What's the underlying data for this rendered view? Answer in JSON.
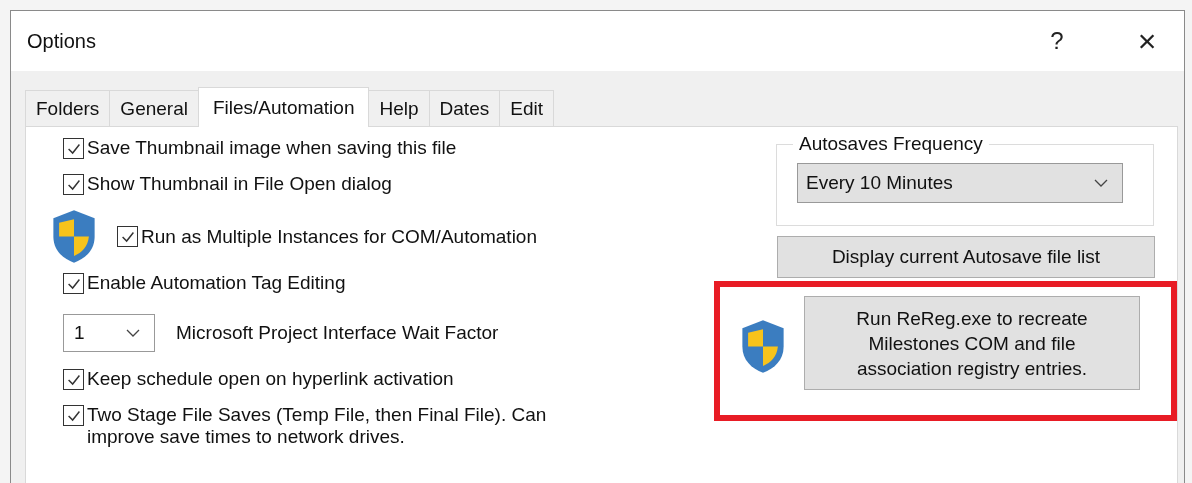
{
  "window": {
    "title": "Options",
    "help_button": "?",
    "close_button": "×"
  },
  "tabs": [
    {
      "label": "Folders",
      "selected": false
    },
    {
      "label": "General",
      "selected": false
    },
    {
      "label": "Files/Automation",
      "selected": true
    },
    {
      "label": "Help",
      "selected": false
    },
    {
      "label": "Dates",
      "selected": false
    },
    {
      "label": "Edit",
      "selected": false
    }
  ],
  "options": [
    {
      "kind": "checkbox",
      "label": "Save Thumbnail image when saving this file",
      "checked": true
    },
    {
      "kind": "checkbox",
      "label": "Show Thumbnail in File Open dialog",
      "checked": true
    },
    {
      "kind": "shield_checkbox",
      "label": "Run as Multiple Instances for COM/Automation",
      "checked": true
    },
    {
      "kind": "checkbox",
      "label": "Enable Automation Tag Editing",
      "checked": true
    },
    {
      "kind": "combo",
      "dropdown": {
        "value": "1"
      },
      "caption": "Microsoft Project Interface Wait Factor"
    },
    {
      "kind": "checkbox",
      "label": "Keep schedule open on hyperlink activation",
      "checked": true
    },
    {
      "kind": "checkbox",
      "label": "Two Stage File Saves (Temp File, then Final File). Can improve save times to network drives.",
      "checked": true
    }
  ],
  "autosave": {
    "title": "Autosaves Frequency",
    "value": "Every 10 Minutes"
  },
  "display_button": "Display current Autosave file list",
  "rereg": {
    "label": "Run ReReg.exe to recreate Milestones COM and file association registry entries.",
    "highlighted": true
  }
}
